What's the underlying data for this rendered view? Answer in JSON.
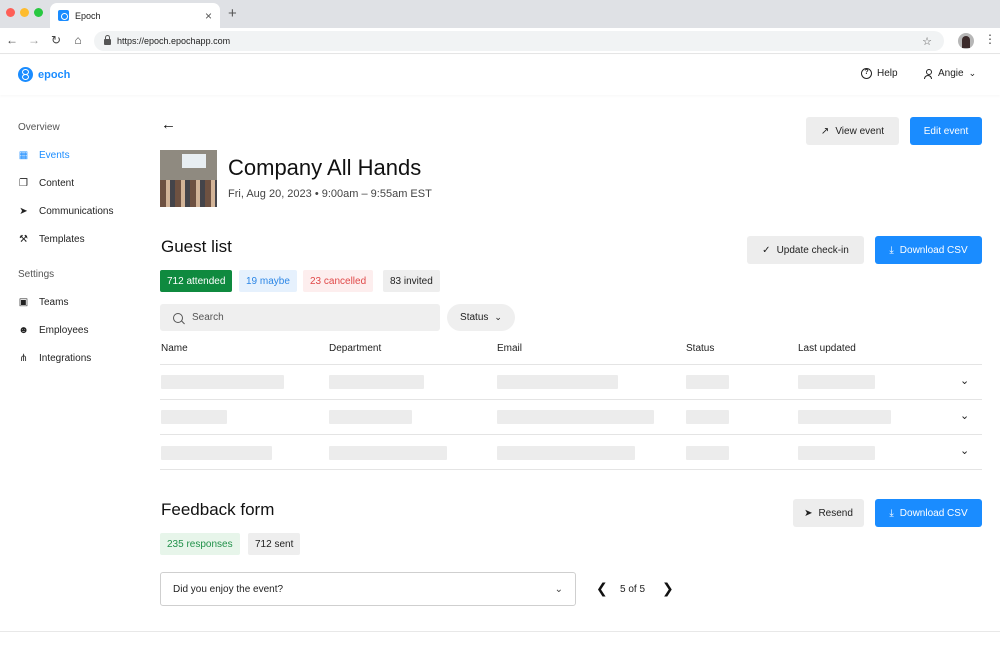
{
  "browser": {
    "tab_title": "Epoch",
    "tab_close": "×",
    "new_tab": "+",
    "url": "https://epoch.epochapp.com"
  },
  "header": {
    "logo_text": "epoch",
    "help_label": "Help",
    "user_name": "Angie"
  },
  "sidebar": {
    "overview_label": "Overview",
    "settings_label": "Settings",
    "items": [
      {
        "label": "Events",
        "icon": "calendar-icon",
        "active": true
      },
      {
        "label": "Content",
        "icon": "content-icon"
      },
      {
        "label": "Communications",
        "icon": "send-icon"
      },
      {
        "label": "Templates",
        "icon": "wrench-icon"
      }
    ],
    "settings_items": [
      {
        "label": "Teams",
        "icon": "building-icon"
      },
      {
        "label": "Employees",
        "icon": "people-icon"
      },
      {
        "label": "Integrations",
        "icon": "integrations-icon"
      }
    ]
  },
  "event": {
    "title": "Company All Hands",
    "date": "Fri, Aug 20, 2023 • 9:00am – 9:55am EST",
    "view_label": "View event",
    "edit_label": "Edit event"
  },
  "guest_list": {
    "heading": "Guest list",
    "update_label": "Update check-in",
    "download_label": "Download CSV",
    "chips": {
      "attended": "712 attended",
      "maybe": "19 maybe",
      "cancelled": "23 cancelled",
      "invited": "83 invited"
    },
    "search_placeholder": "Search",
    "status_filter": "Status",
    "columns": [
      "Name",
      "Department",
      "Email",
      "Status",
      "Last updated"
    ]
  },
  "feedback": {
    "heading": "Feedback form",
    "resend_label": "Resend",
    "download_label": "Download CSV",
    "responses": "235 responses",
    "sent": "712 sent",
    "question": "Did you enjoy the event?",
    "pager": "5 of 5"
  },
  "colors": {
    "accent": "#1a8cff",
    "attended": "#0f8a3f",
    "cancelled": "#e04848"
  }
}
